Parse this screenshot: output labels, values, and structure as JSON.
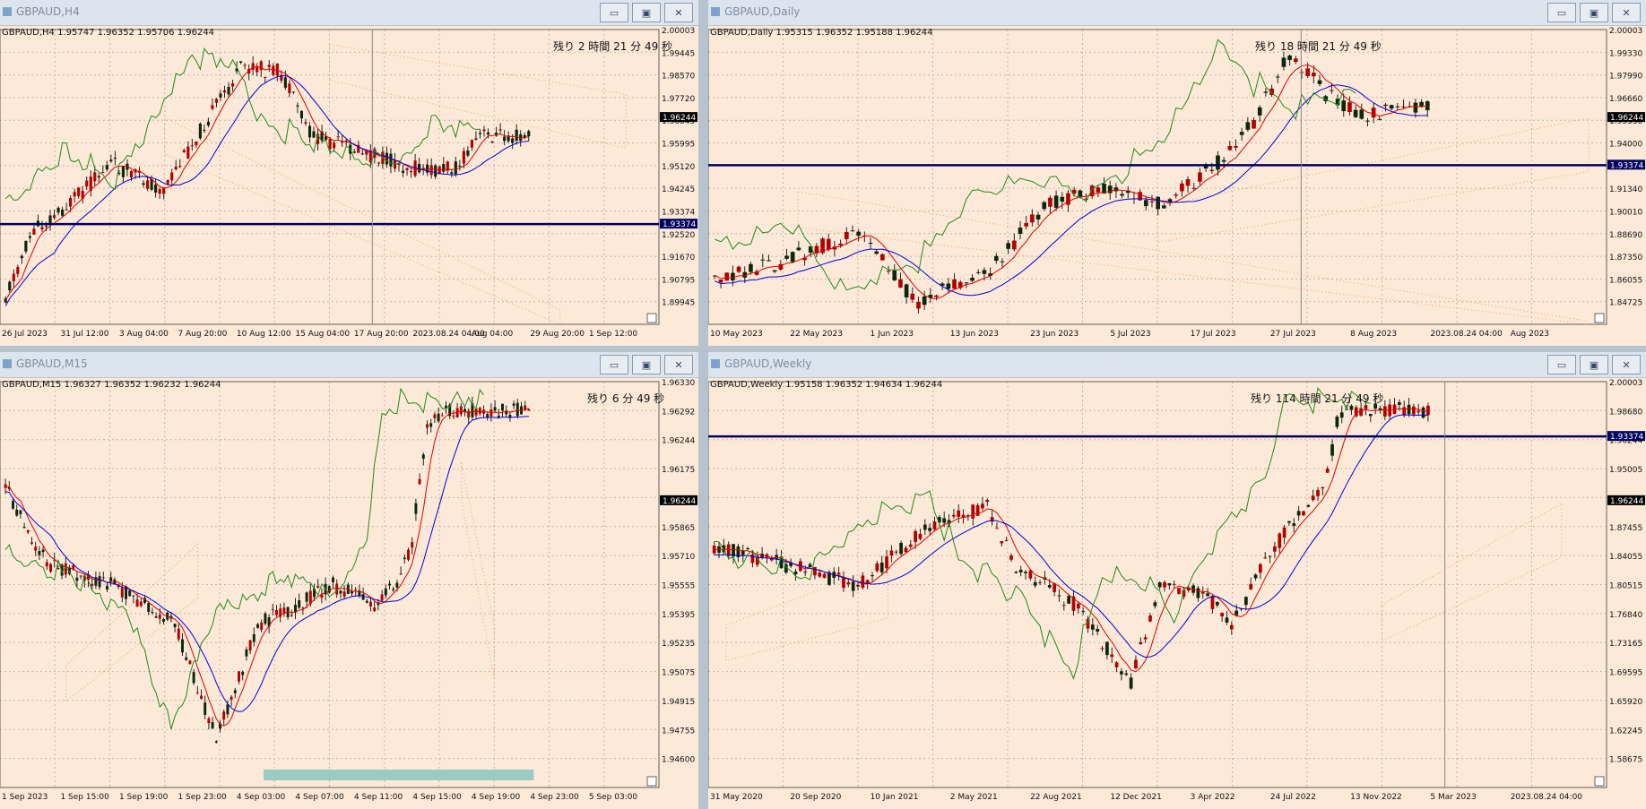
{
  "colors": {
    "background": "#fde9d7",
    "grid": "#c7b7a8",
    "bull": "#b30000",
    "bear": "#0a280a",
    "tenkan": "#e00000",
    "kijun": "#0000e0",
    "chikou": "#1f8a1f",
    "level": "#000060",
    "kumo": "#e8a070"
  },
  "window_buttons": {
    "minimize": "▭",
    "restore": "▣",
    "close": "✕"
  },
  "windows": [
    {
      "title": "GBPAUD,H4",
      "info": "GBPAUD,H4  1.95747 1.96352 1.95706 1.96244",
      "remain": "残り 2 時間 21 分 49 秒",
      "yticks": [
        "2.00003",
        "1.99445",
        "1.98570",
        "1.97720",
        "1.96845",
        "1.95995",
        "1.95120",
        "1.94245",
        "1.93374",
        "1.92520",
        "1.91670",
        "1.90795",
        "1.89945"
      ],
      "price_badge": "1.96244",
      "level_badge": "1.93374",
      "xticks": [
        "26 Jul 2023",
        "31 Jul 12:00",
        "3 Aug 04:00",
        "7 Aug 20:00",
        "10 Aug 12:00",
        "15 Aug 04:00",
        "17 Aug 20:00",
        "2023.08.24 04:00",
        "Aug 04:00",
        "29 Aug 20:00",
        "1 Sep 12:00"
      ]
    },
    {
      "title": "GBPAUD,Daily",
      "info": "GBPAUD,Daily  1.95315 1.96352 1.95188 1.96244",
      "remain": "残り 18 時間 21 分 49 秒",
      "yticks": [
        "2.00003",
        "1.99330",
        "1.97990",
        "1.96660",
        "1.95330",
        "1.94000",
        "1.92670",
        "1.91340",
        "1.90010",
        "1.88690",
        "1.87350",
        "1.86055",
        "1.84725"
      ],
      "price_badge": "1.96244",
      "level_badge": "1.93374",
      "xticks": [
        "10 May 2023",
        "22 May 2023",
        "1 Jun 2023",
        "13 Jun 2023",
        "23 Jun 2023",
        "5 Jul 2023",
        "17 Jul 2023",
        "27 Jul 2023",
        "8 Aug 2023",
        "2023.08.24 04:00",
        "Aug 2023"
      ]
    },
    {
      "title": "GBPAUD,M15",
      "info": "GBPAUD,M15  1.96327 1.96352 1.96232 1.96244",
      "remain": "残り 6 分 49 秒",
      "yticks": [
        "1.96330",
        "1.96292",
        "1.96244",
        "1.96175",
        "1.96020",
        "1.95865",
        "1.95710",
        "1.95555",
        "1.95395",
        "1.95235",
        "1.95075",
        "1.94915",
        "1.94755",
        "1.94600"
      ],
      "price_badge": "1.96244",
      "level_badge": "",
      "xticks": [
        "1 Sep 2023",
        "1 Sep 15:00",
        "1 Sep 19:00",
        "1 Sep 23:00",
        "4 Sep 03:00",
        "4 Sep 07:00",
        "4 Sep 11:00",
        "4 Sep 15:00",
        "4 Sep 19:00",
        "4 Sep 23:00",
        "5 Sep 03:00"
      ]
    },
    {
      "title": "GBPAUD,Weekly",
      "info": "GBPAUD,Weekly  1.95158 1.96352 1.94634 1.96244",
      "remain": "残り 114 時間 21 分 49 秒",
      "yticks": [
        "2.00003",
        "1.98680",
        "1.96244",
        "1.95005",
        "1.93374",
        "1.87455",
        "1.84055",
        "1.80515",
        "1.76840",
        "1.73165",
        "1.69595",
        "1.65920",
        "1.62245",
        "1.58675"
      ],
      "price_badge": "1.96244",
      "level_badge": "1.93374",
      "xticks": [
        "31 May 2020",
        "20 Sep 2020",
        "10 Jan 2021",
        "2 May 2021",
        "22 Aug 2021",
        "12 Dec 2021",
        "3 Apr 2022",
        "24 Jul 2022",
        "13 Nov 2022",
        "5 Mar 2023",
        "2023.08.24 04:00"
      ]
    }
  ]
}
